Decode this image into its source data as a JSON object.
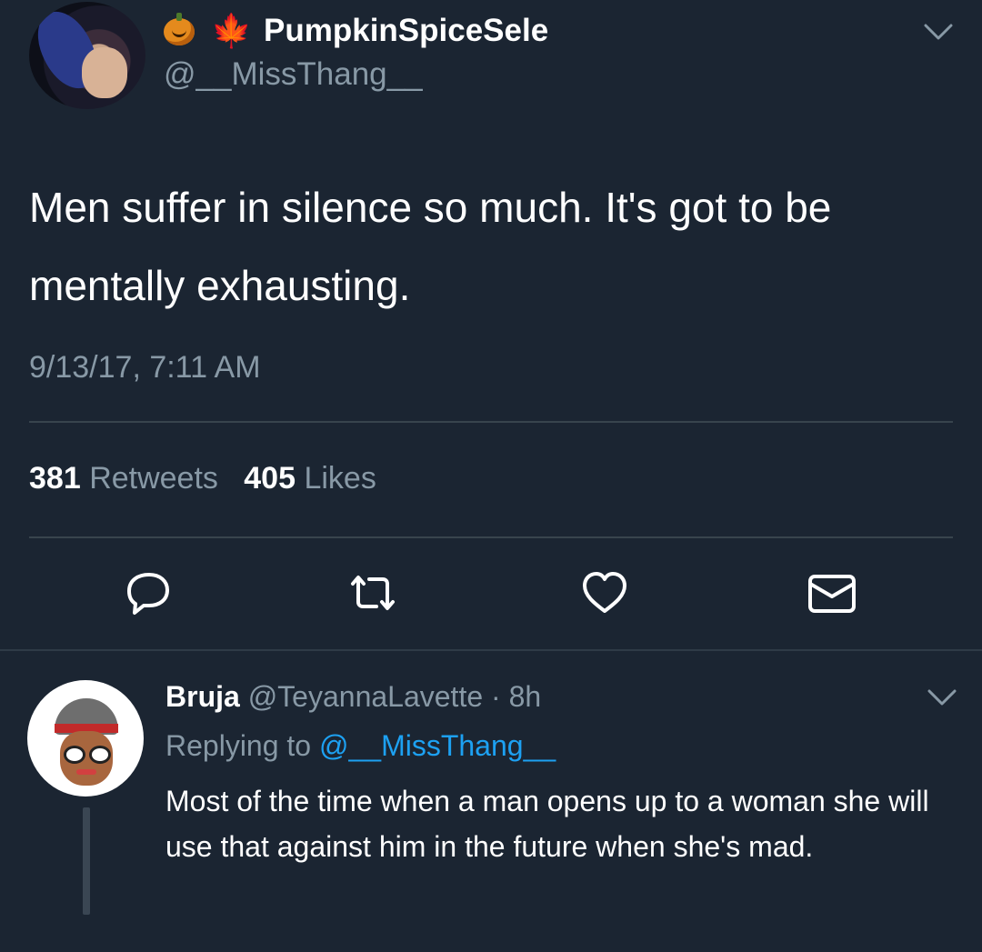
{
  "tweet": {
    "display_name": "PumpkinSpiceSele",
    "handle": "@__MissThang__",
    "text": "Men suffer in silence so much. It's got to be mentally exhausting.",
    "timestamp": "9/13/17, 7:11 AM",
    "retweets_count": "381",
    "retweets_label": "Retweets",
    "likes_count": "405",
    "likes_label": "Likes",
    "name_emojis": [
      "jack-o-lantern",
      "maple-leaf"
    ]
  },
  "reply": {
    "display_name": "Bruja",
    "meta": "@TeyannaLavette · 8h",
    "replying_prefix": "Replying to",
    "replying_mention": "@__MissThang__",
    "text": "Most of the time when a man opens up to a woman she will use that against him in the future when she's mad."
  },
  "colors": {
    "background": "#1b2532",
    "secondary_text": "#8899a6",
    "link": "#1da1f2"
  }
}
